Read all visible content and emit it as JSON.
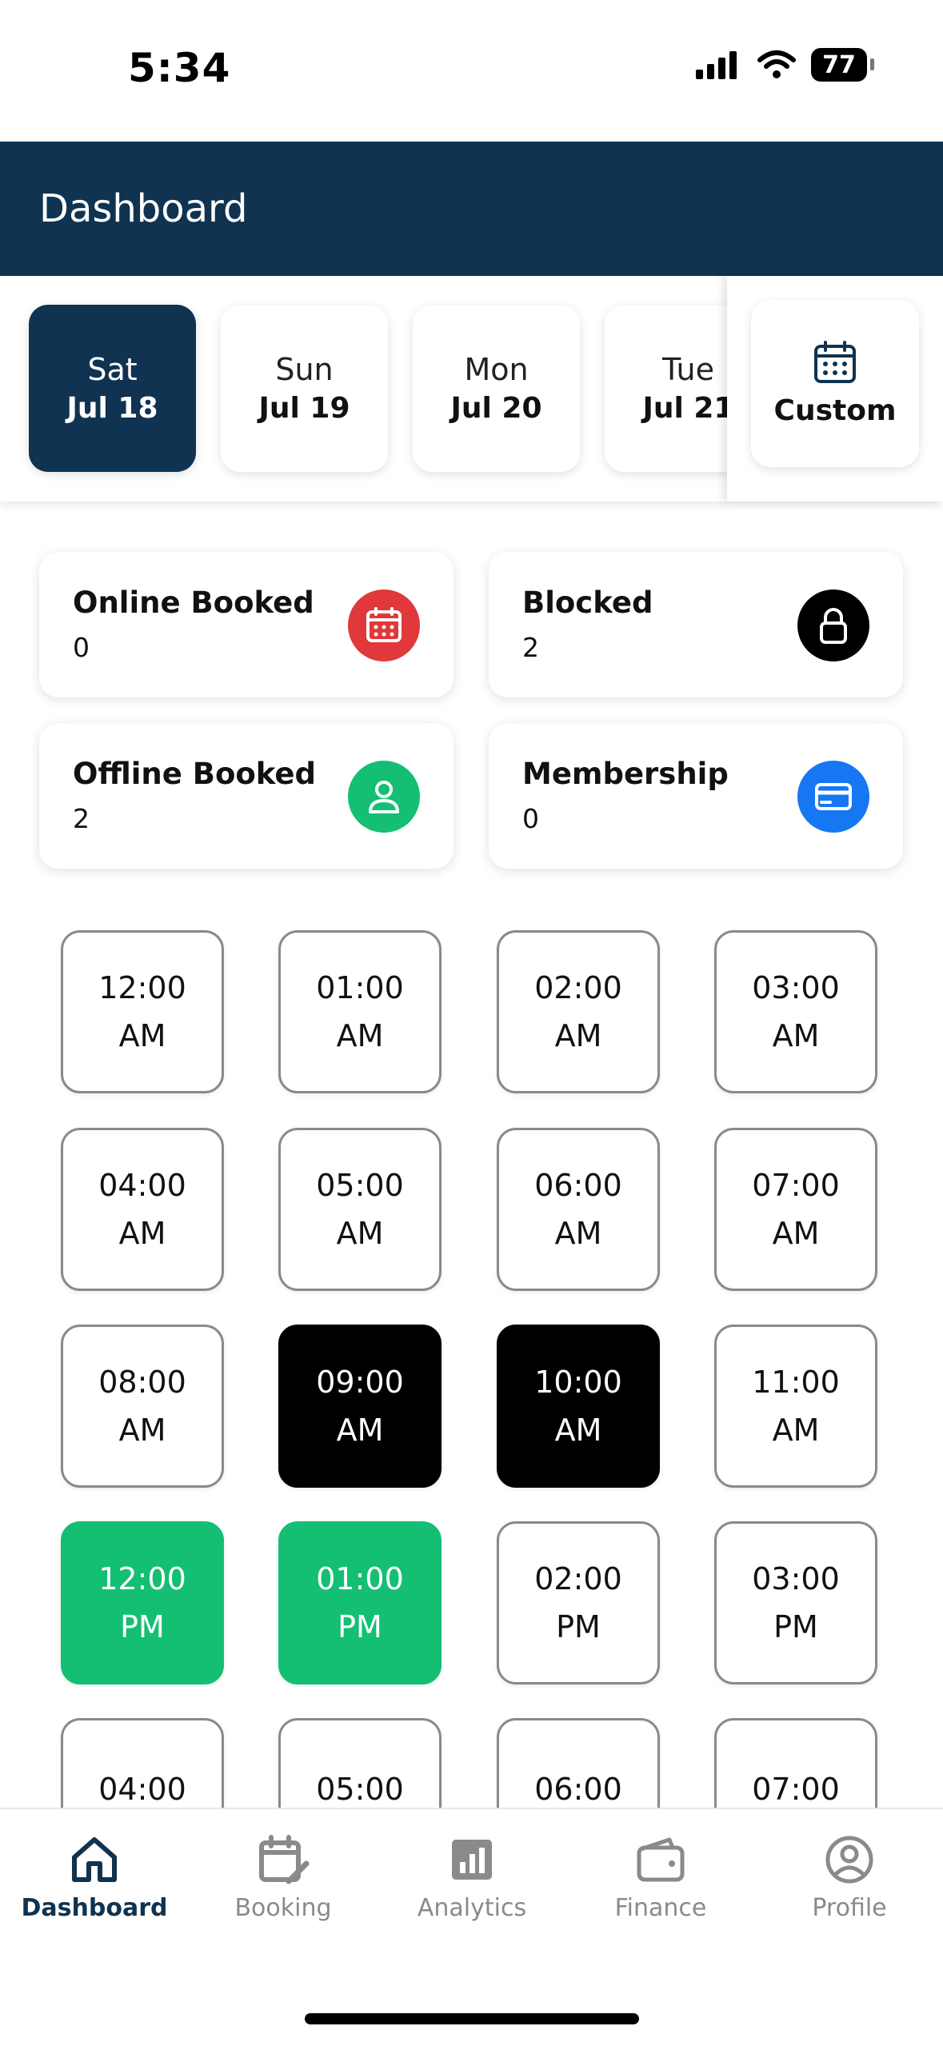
{
  "status_bar": {
    "time": "5:34",
    "battery": "77"
  },
  "header": {
    "title": "Dashboard"
  },
  "dates": [
    {
      "dow": "Sat",
      "date": "Jul 18",
      "selected": true
    },
    {
      "dow": "Sun",
      "date": "Jul 19",
      "selected": false
    },
    {
      "dow": "Mon",
      "date": "Jul 20",
      "selected": false
    },
    {
      "dow": "Tue",
      "date": "Jul 21",
      "selected": false
    }
  ],
  "custom": {
    "label": "Custom",
    "icon": "calendar-icon"
  },
  "stats": [
    {
      "title": "Online Booked",
      "value": "0",
      "icon": "calendar-icon",
      "color": "#e0383b"
    },
    {
      "title": "Blocked",
      "value": "2",
      "icon": "lock-icon",
      "color": "#000000"
    },
    {
      "title": "Offline Booked",
      "value": "2",
      "icon": "user-icon",
      "color": "#14bf73"
    },
    {
      "title": "Membership",
      "value": "0",
      "icon": "card-icon",
      "color": "#1677f2"
    }
  ],
  "slots": [
    {
      "time": "12:00",
      "period": "AM",
      "state": "free"
    },
    {
      "time": "01:00",
      "period": "AM",
      "state": "free"
    },
    {
      "time": "02:00",
      "period": "AM",
      "state": "free"
    },
    {
      "time": "03:00",
      "period": "AM",
      "state": "free"
    },
    {
      "time": "04:00",
      "period": "AM",
      "state": "free"
    },
    {
      "time": "05:00",
      "period": "AM",
      "state": "free"
    },
    {
      "time": "06:00",
      "period": "AM",
      "state": "free"
    },
    {
      "time": "07:00",
      "period": "AM",
      "state": "free"
    },
    {
      "time": "08:00",
      "period": "AM",
      "state": "free"
    },
    {
      "time": "09:00",
      "period": "AM",
      "state": "blocked"
    },
    {
      "time": "10:00",
      "period": "AM",
      "state": "blocked"
    },
    {
      "time": "11:00",
      "period": "AM",
      "state": "free"
    },
    {
      "time": "12:00",
      "period": "PM",
      "state": "offline"
    },
    {
      "time": "01:00",
      "period": "PM",
      "state": "offline"
    },
    {
      "time": "02:00",
      "period": "PM",
      "state": "free"
    },
    {
      "time": "03:00",
      "period": "PM",
      "state": "free"
    },
    {
      "time": "04:00",
      "period": "",
      "state": "free"
    },
    {
      "time": "05:00",
      "period": "",
      "state": "free"
    },
    {
      "time": "06:00",
      "period": "",
      "state": "free"
    },
    {
      "time": "07:00",
      "period": "",
      "state": "free"
    }
  ],
  "nav": [
    {
      "label": "Dashboard",
      "icon": "home-icon",
      "active": true
    },
    {
      "label": "Booking",
      "icon": "calendar-edit-icon",
      "active": false
    },
    {
      "label": "Analytics",
      "icon": "analytics-icon",
      "active": false
    },
    {
      "label": "Finance",
      "icon": "wallet-icon",
      "active": false
    },
    {
      "label": "Profile",
      "icon": "profile-icon",
      "active": false
    }
  ],
  "colors": {
    "primary": "#0f3350",
    "blocked": "#000000",
    "offline": "#14bf73"
  }
}
